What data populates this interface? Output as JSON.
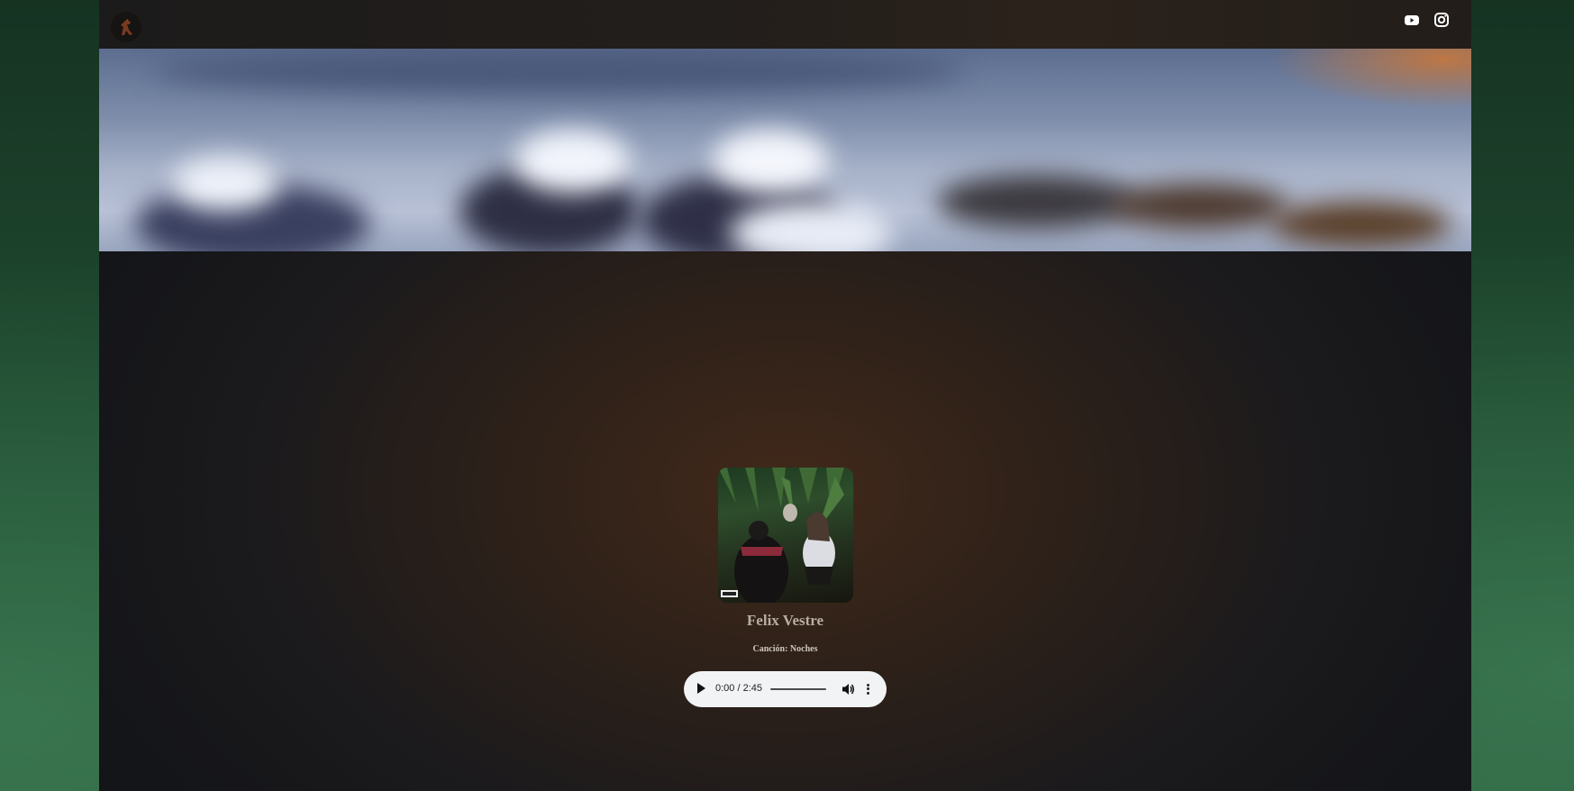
{
  "header": {
    "logo_icon": "horse-logo-icon",
    "social": [
      {
        "name": "youtube-icon"
      },
      {
        "name": "instagram-icon"
      }
    ]
  },
  "banner": {
    "image": "blurred-sneakers-banner"
  },
  "track": {
    "cover_image": "album-cover-photo",
    "artist": "Felix Vestre",
    "song_label": "Canción: Noches"
  },
  "player": {
    "time": "0:00 / 2:45",
    "progress": 0,
    "icons": [
      "play-icon",
      "volume-icon",
      "more-options-icon"
    ]
  },
  "colors": {
    "page_bg": "#1b1a1c",
    "glow": "#42291a",
    "side_bg": "#1f4a30",
    "player_bg": "#f1f3f4",
    "artist_text": "#b8ada2"
  }
}
